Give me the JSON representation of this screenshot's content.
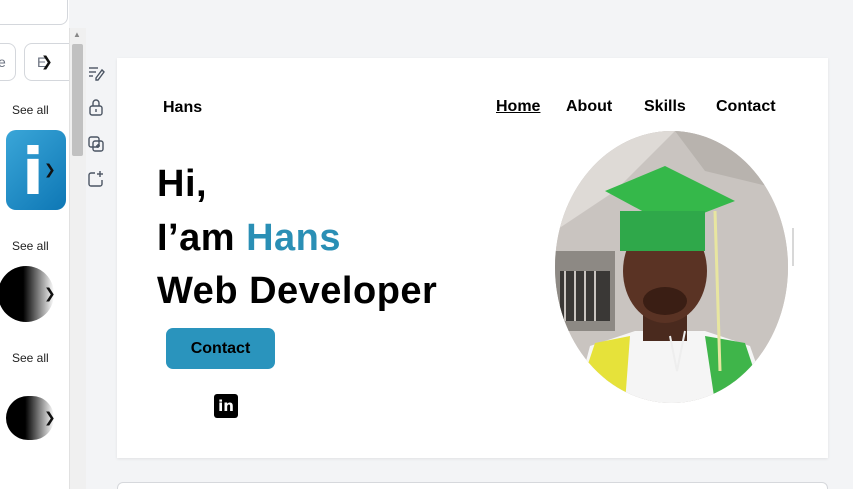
{
  "sidebar": {
    "chip_left_text": "e",
    "chip_right_text": "E",
    "see_all_1": "See all",
    "see_all_2": "See all",
    "see_all_3": "See all",
    "linkedin_thumb_letter": "i"
  },
  "tools": [
    "edit-notes-icon",
    "lock-icon",
    "duplicate-icon",
    "add-page-icon"
  ],
  "site": {
    "brand": "Hans",
    "nav": {
      "home": "Home",
      "about": "About",
      "skills": "Skills",
      "contact": "Contact"
    },
    "hero": {
      "line1": "Hi,",
      "line2_prefix": "I’am ",
      "line2_name": "Hans",
      "line3": "Web Developer"
    },
    "cta_label": "Contact",
    "linkedin_label": "in"
  },
  "colors": {
    "accent": "#2a8fb5",
    "button": "#2a94bd",
    "canvas": "#ffffff",
    "workspace": "#f3f4f6"
  }
}
